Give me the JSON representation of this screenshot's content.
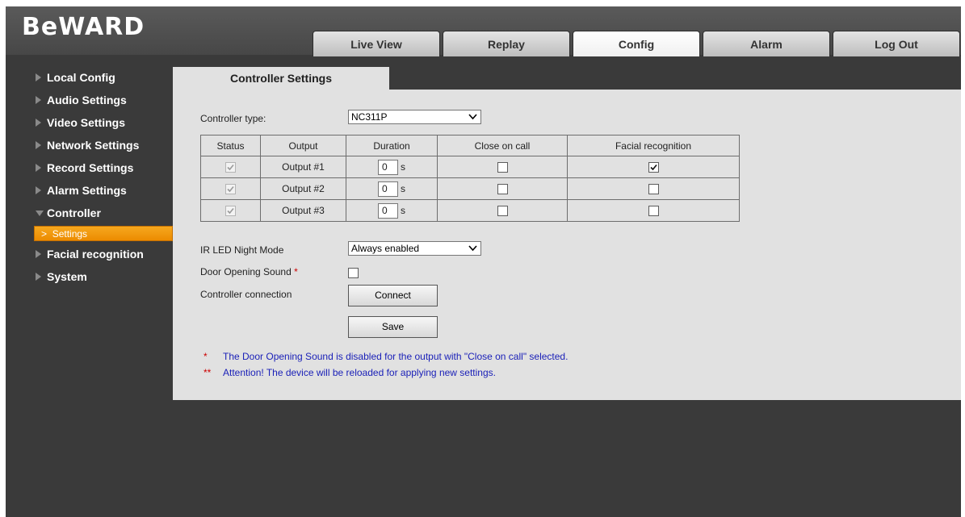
{
  "brand": {
    "logo_text": "BeWARD"
  },
  "nav": {
    "tabs": [
      "Live View",
      "Replay",
      "Config",
      "Alarm",
      "Log Out"
    ],
    "active": "Config"
  },
  "sidebar": {
    "items": [
      "Local Config",
      "Audio Settings",
      "Video Settings",
      "Network Settings",
      "Record Settings",
      "Alarm Settings",
      "Controller",
      "Facial recognition",
      "System"
    ],
    "expanded": "Controller",
    "sub_item": "Settings"
  },
  "panel": {
    "title": "Controller Settings",
    "controller_type": {
      "label": "Controller type:",
      "value": "NC311P"
    },
    "table": {
      "headers": [
        "Status",
        "Output",
        "Duration",
        "Close on call",
        "Facial recognition"
      ],
      "rows": [
        {
          "status": true,
          "output": "Output #1",
          "duration": "0",
          "unit": "s",
          "close_on_call": false,
          "facial_recognition": true
        },
        {
          "status": true,
          "output": "Output #2",
          "duration": "0",
          "unit": "s",
          "close_on_call": false,
          "facial_recognition": false
        },
        {
          "status": true,
          "output": "Output #3",
          "duration": "0",
          "unit": "s",
          "close_on_call": false,
          "facial_recognition": false
        }
      ]
    },
    "ir_led": {
      "label": "IR LED Night Mode",
      "value": "Always enabled"
    },
    "door_sound": {
      "label": "Door Opening Sound",
      "marker": "*",
      "checked": false
    },
    "connection": {
      "label": "Controller connection",
      "button": "Connect"
    },
    "save_button": "Save",
    "notes": [
      {
        "marker": "*",
        "text": "The Door Opening Sound is disabled for the output with \"Close on call\" selected."
      },
      {
        "marker": "**",
        "text": "Attention! The device will be reloaded for applying new settings."
      }
    ]
  },
  "colors": {
    "accent": "#f39c12",
    "note_text": "#1b21b8",
    "required_marker": "#cc0000",
    "panel_bg": "#e1e1e1",
    "app_bg": "#3a3a3a"
  }
}
